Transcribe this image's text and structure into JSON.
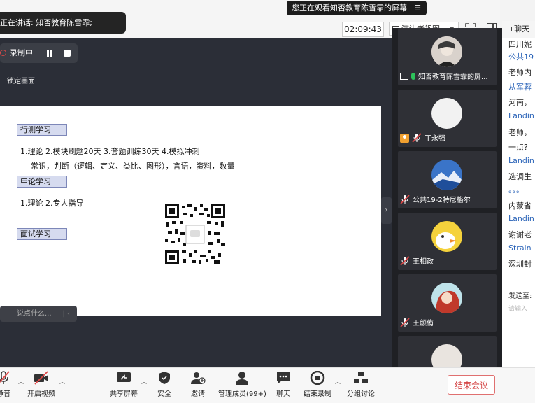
{
  "top": {
    "speaking_text": "正在讲话: 知否教育陈雪霏;",
    "viewing_banner": "您正在观看知否教育陈雪霏的屏幕",
    "menu_glyph": "☰",
    "timer": "02:09:43",
    "view_mode": "演讲者视图"
  },
  "recording": {
    "status": "录制中",
    "lock_label": "锁定画面"
  },
  "slide": {
    "section1": "行测学习",
    "line1": "1.理论   2.模块刷题20天   3.套题训练30天   4.模拟冲刺",
    "line2": "常识，判断（逻辑、定义、类比、图形），言语，资料，数量",
    "section2": "申论学习",
    "line3": "1.理论    2.专人指导",
    "section3": "面试学习"
  },
  "chat_hint": "说点什么...",
  "participants": [
    {
      "name": "知否教育陈雪霏的屏..."
    },
    {
      "name": "丁永强"
    },
    {
      "name": "公共19-2特尼格尔"
    },
    {
      "name": "王相政"
    },
    {
      "name": "王颜侑"
    }
  ],
  "chat": {
    "title": "聊天",
    "lines": [
      "四川妮",
      "公共19",
      "老师内",
      "从军蓉",
      "河南，",
      "Landin",
      "老师，",
      "一点?",
      "Landin",
      "选调生",
      "。。。",
      "内蒙省",
      "Landin",
      "谢谢老",
      "Strain",
      "深圳封"
    ],
    "send_to": "发送至:",
    "input_placeholder": "请输入"
  },
  "toolbar": {
    "mute": "静音",
    "video": "开启视频",
    "share": "共享屏幕",
    "security": "安全",
    "invite": "邀请",
    "members": "管理成员(99+)",
    "chat": "聊天",
    "end_recording": "结束录制",
    "breakout": "分组讨论",
    "end_meeting": "结束会议"
  },
  "colors": {
    "accent_blue": "#2a63b8",
    "record_red": "#e04848",
    "end_red": "#d23b3b",
    "mic_green": "#2dc35a"
  }
}
